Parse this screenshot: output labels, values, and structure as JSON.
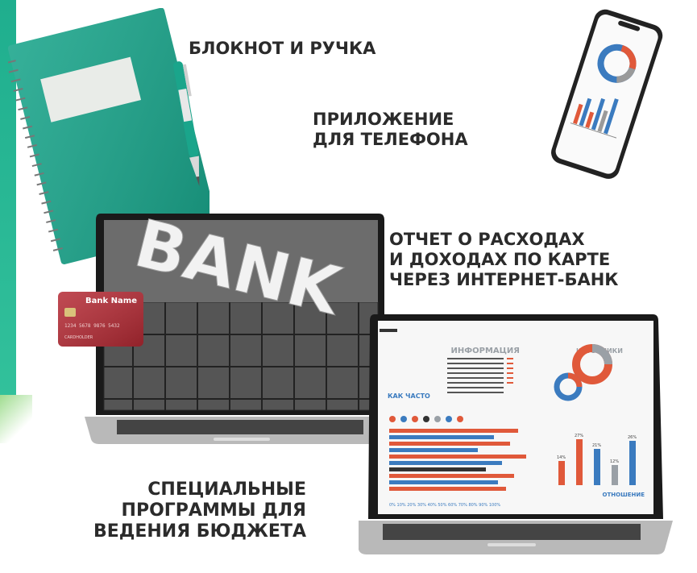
{
  "labels": {
    "notebook": [
      "БЛОКНОТ И РУЧКА"
    ],
    "phone": [
      "ПРИЛОЖЕНИЕ",
      "ДЛЯ ТЕЛЕФОНА"
    ],
    "report": [
      "ОТЧЕТ О РАСХОДАХ",
      "И ДОХОДАХ ПО КАРТЕ",
      "ЧЕРЕЗ ИНТЕРНЕТ-БАНК"
    ],
    "programs": [
      "СПЕЦИАЛЬНЫЕ",
      "ПРОГРАММЫ ДЛЯ",
      "ВЕДЕНИЯ БЮДЖЕТА"
    ]
  },
  "laptop_screen": {
    "sign_text": "BANK"
  },
  "bank_card": {
    "bank_name": "Bank Name",
    "number": "1234 5678 9876 5432",
    "holder": "CARDHOLDER"
  },
  "infographic": {
    "title": "ИНФОРМАЦИЯ",
    "sources_title": "ИСТОЧНИКИ",
    "left_heading": "КАК ЧАСТО",
    "bottom_heading": "ОТНОШЕНИЕ",
    "percent_axis": [
      "0%",
      "10%",
      "20%",
      "30%",
      "40%",
      "50%",
      "60%",
      "70%",
      "80%",
      "90%",
      "100%"
    ],
    "bar_values": [
      "14%",
      "27%",
      "21%",
      "12%",
      "26%"
    ]
  },
  "colors": {
    "notebook": "#1aa58b",
    "accent_orange": "#e0593a",
    "accent_blue": "#3b7bbf",
    "text_dark": "#2b2b2b"
  }
}
